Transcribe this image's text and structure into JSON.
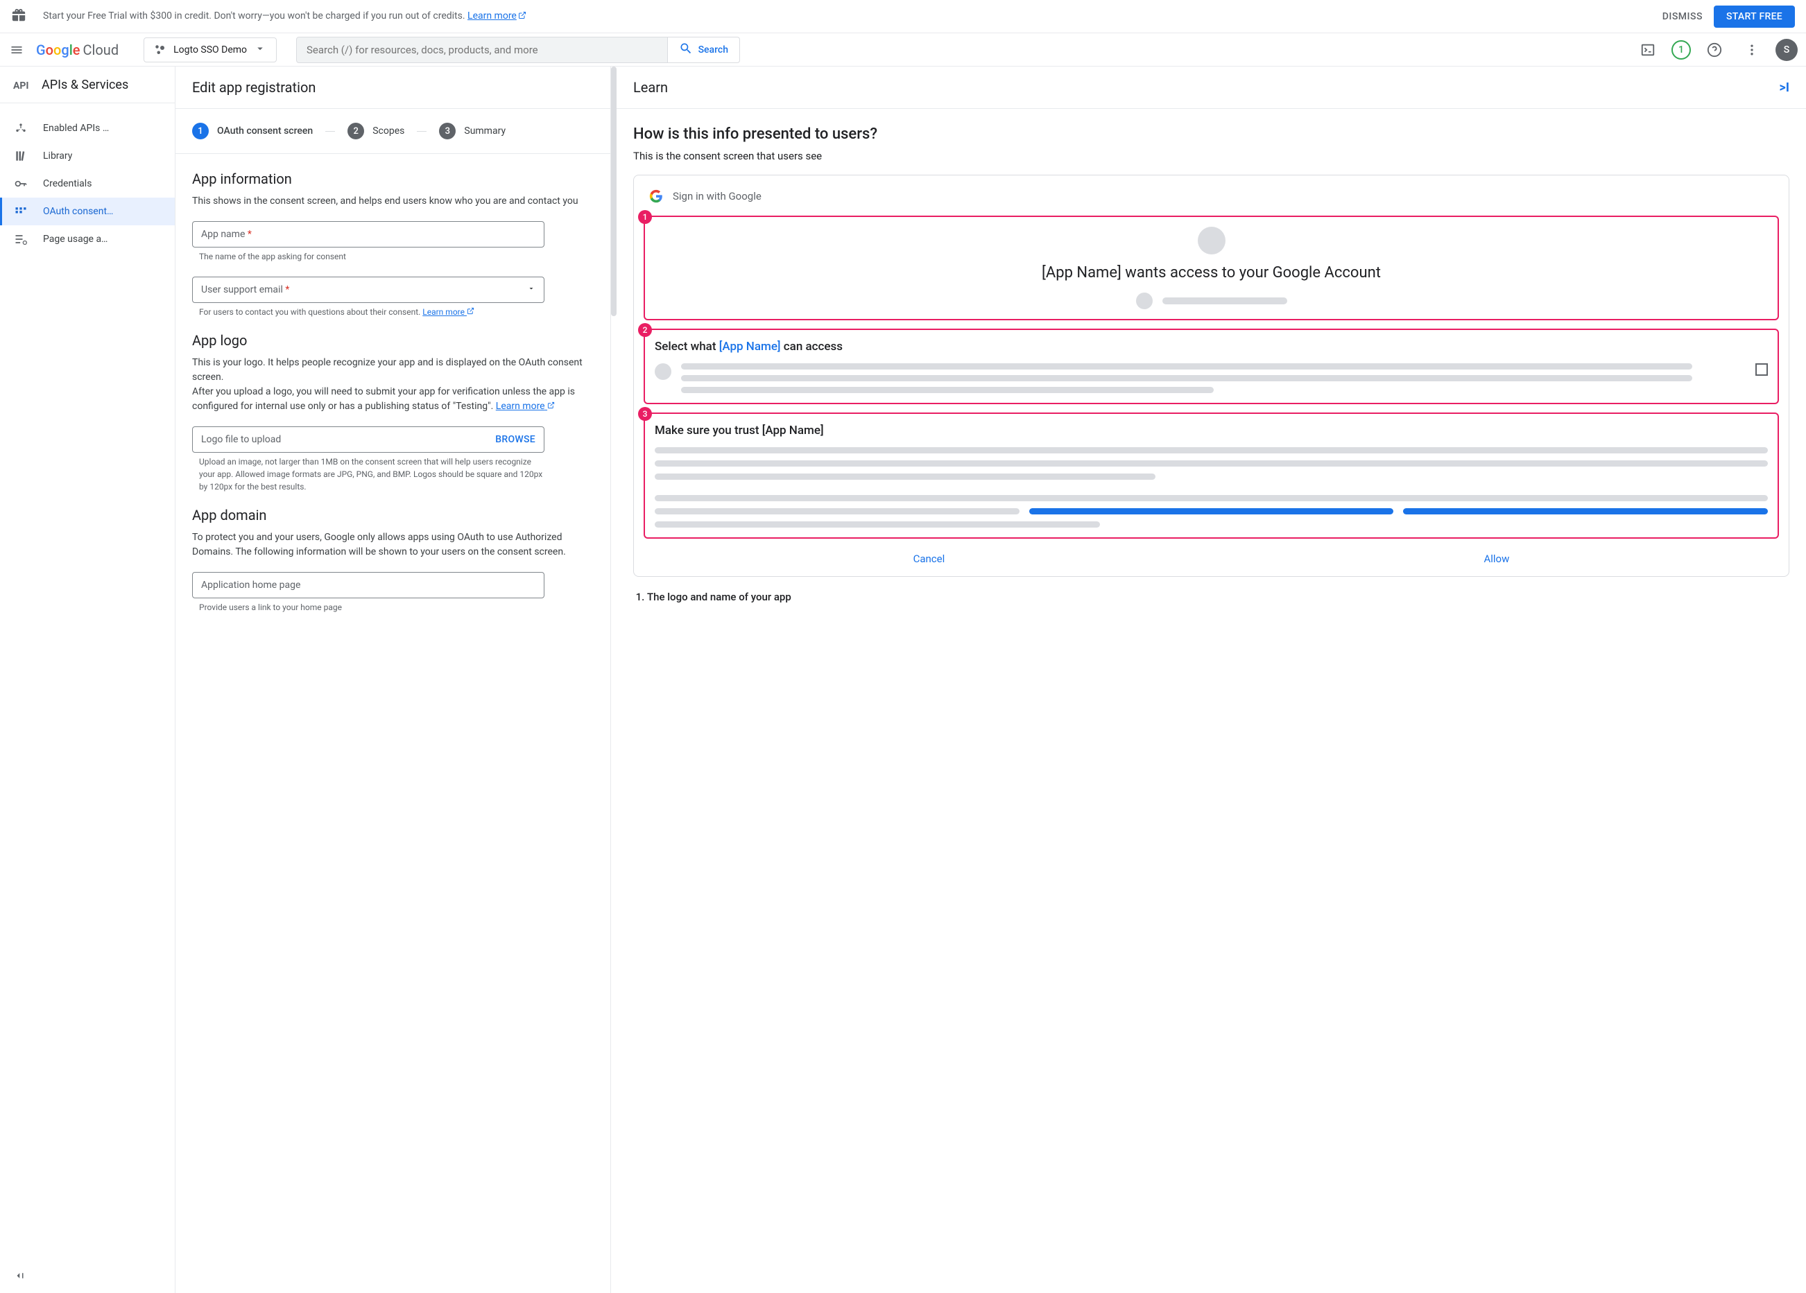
{
  "promo": {
    "text": "Start your Free Trial with $300 in credit. Don't worry—you won't be charged if you run out of credits. ",
    "learn_more": "Learn more",
    "dismiss": "DISMISS",
    "start_free": "START FREE"
  },
  "header": {
    "logo_cloud": " Cloud",
    "project_name": "Logto SSO Demo",
    "search_placeholder": "Search (/) for resources, docs, products, and more",
    "search_label": "Search",
    "notif_count": "1",
    "avatar_letter": "S"
  },
  "sidebar": {
    "title": "APIs & Services",
    "items": [
      {
        "label": "Enabled APIs …"
      },
      {
        "label": "Library"
      },
      {
        "label": "Credentials"
      },
      {
        "label": "OAuth consent…"
      },
      {
        "label": "Page usage a…"
      }
    ]
  },
  "stepper": {
    "page_title": "Edit app registration",
    "steps": [
      "OAuth consent screen",
      "Scopes",
      "Summary"
    ]
  },
  "form": {
    "app_info": {
      "title": "App information",
      "desc": "This shows in the consent screen, and helps end users know who you are and contact you",
      "app_name_label": "App name ",
      "app_name_hint": "The name of the app asking for consent",
      "support_email_label": "User support email ",
      "support_email_hint": "For users to contact you with questions about their consent. ",
      "learn_more": "Learn more"
    },
    "app_logo": {
      "title": "App logo",
      "desc1": "This is your logo. It helps people recognize your app and is displayed on the OAuth consent screen.",
      "desc2": "After you upload a logo, you will need to submit your app for verification unless the app is configured for internal use only or has a publishing status of \"Testing\". ",
      "learn_more": "Learn more",
      "upload_label": "Logo file to upload",
      "browse": "BROWSE",
      "upload_hint": "Upload an image, not larger than 1MB on the consent screen that will help users recognize your app. Allowed image formats are JPG, PNG, and BMP. Logos should be square and 120px by 120px for the best results."
    },
    "app_domain": {
      "title": "App domain",
      "desc": "To protect you and your users, Google only allows apps using OAuth to use Authorized Domains. The following information will be shown to your users on the consent screen.",
      "home_page_label": "Application home page",
      "home_page_hint": "Provide users a link to your home page"
    }
  },
  "learn": {
    "title": "Learn",
    "heading": "How is this info presented to users?",
    "sub": "This is the consent screen that users see",
    "signin_text": "Sign in with Google",
    "box1_text": "[App Name] wants access to your Google Account",
    "box2_prefix": "Select what ",
    "box2_app": "[App Name]",
    "box2_suffix": " can access",
    "box3_text": "Make sure you trust [App Name]",
    "cancel": "Cancel",
    "allow": "Allow",
    "list1": "The logo and name of your app"
  }
}
